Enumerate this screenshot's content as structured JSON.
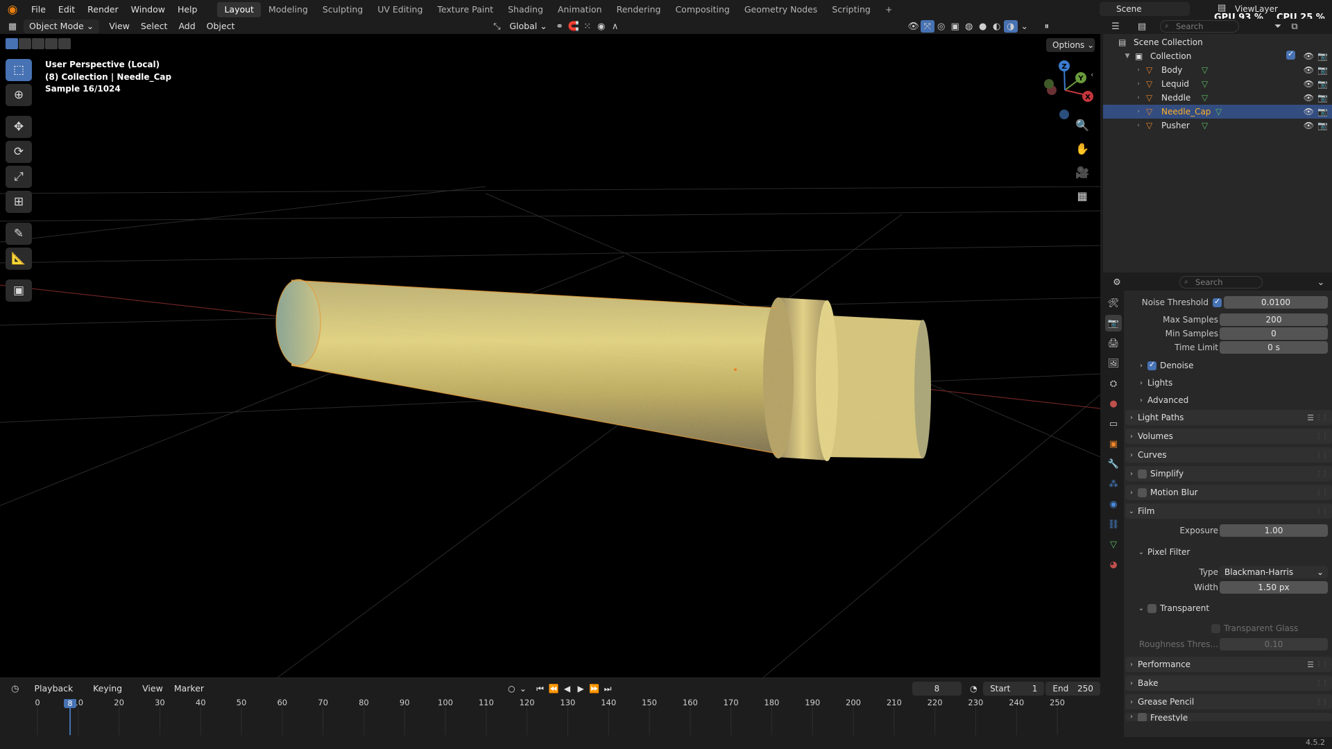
{
  "menu": [
    "File",
    "Edit",
    "Render",
    "Window",
    "Help"
  ],
  "workspaces": [
    "Layout",
    "Modeling",
    "Sculpting",
    "UV Editing",
    "Texture Paint",
    "Shading",
    "Animation",
    "Rendering",
    "Compositing",
    "Geometry Nodes",
    "Scripting"
  ],
  "add_workspace": "+",
  "scene": "Scene",
  "view_layer": "ViewLayer",
  "gpu": "GPU 93 %",
  "cpu": "CPU 25 %",
  "viewport_header": {
    "mode": "Object Mode",
    "view": "View",
    "select": "Select",
    "add": "Add",
    "object": "Object",
    "orientation": "Global",
    "options": "Options"
  },
  "overlay": {
    "line1": "User Perspective (Local)",
    "line2": "(8) Collection | Needle_Cap",
    "line3": "Sample 16/1024"
  },
  "gizmo": {
    "x": "X",
    "y": "Y",
    "z": "Z"
  },
  "timeline": {
    "playback": "Playback",
    "keying": "Keying",
    "view": "View",
    "marker": "Marker",
    "current_frame": "8",
    "start_label": "Start",
    "start": "1",
    "end_label": "End",
    "end": "250",
    "ticks": [
      "0",
      "10",
      "20",
      "30",
      "40",
      "50",
      "60",
      "70",
      "80",
      "90",
      "100",
      "110",
      "120",
      "130",
      "140",
      "150",
      "160",
      "170",
      "180",
      "190",
      "200",
      "210",
      "220",
      "230",
      "240",
      "250"
    ],
    "playhead": "8"
  },
  "outliner": {
    "search_placeholder": "Search",
    "scene_collection": "Scene Collection",
    "collection": "Collection",
    "objects": [
      "Body",
      "Lequid",
      "Neddle",
      "Needle_Cap",
      "Pusher"
    ],
    "selected": "Needle_Cap"
  },
  "properties": {
    "search_placeholder": "Search",
    "noise_threshold_label": "Noise Threshold",
    "noise_threshold": "0.0100",
    "max_samples_label": "Max Samples",
    "max_samples": "200",
    "min_samples_label": "Min Samples",
    "min_samples": "0",
    "time_limit_label": "Time Limit",
    "time_limit": "0 s",
    "denoise": "Denoise",
    "lights": "Lights",
    "advanced": "Advanced",
    "light_paths": "Light Paths",
    "volumes": "Volumes",
    "curves": "Curves",
    "simplify": "Simplify",
    "motion_blur": "Motion Blur",
    "film": "Film",
    "exposure_label": "Exposure",
    "exposure": "1.00",
    "pixel_filter": "Pixel Filter",
    "type_label": "Type",
    "type": "Blackman-Harris",
    "width_label": "Width",
    "width": "1.50 px",
    "transparent": "Transparent",
    "transparent_glass": "Transparent Glass",
    "roughness_label": "Roughness Thres...",
    "roughness": "0.10",
    "performance": "Performance",
    "bake": "Bake",
    "grease_pencil": "Grease Pencil",
    "freestyle": "Freestyle"
  },
  "version": "4.5.2",
  "colors": {
    "accent_blue": "#4772b3",
    "selection_orange": "#ffaf29",
    "object_orange": "#e8832a",
    "mesh_green": "#5dbb63"
  }
}
